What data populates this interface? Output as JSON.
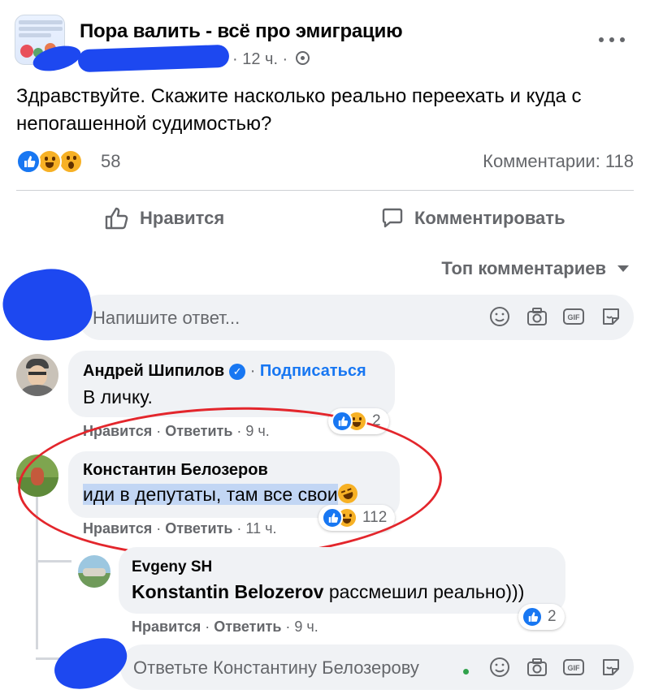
{
  "post": {
    "group_name": "Пора валить - всё про эмиграцию",
    "time_ago": "12 ч.",
    "text": "Здравствуйте. Скажите насколько реально переехать и куда с непогашенной судимостью?",
    "reaction_count": "58",
    "comments_label": "Комментарии: 118",
    "like_label": "Нравится",
    "comment_label": "Комментировать",
    "reaction_types": [
      "like",
      "haha",
      "wow"
    ]
  },
  "comments_section": {
    "sort_label": "Топ комментариев",
    "reply_placeholder": "Напишите ответ...",
    "input_icons": [
      "smiley-icon",
      "camera-icon",
      "gif-icon",
      "sticker-icon"
    ]
  },
  "comments": [
    {
      "author": "Андрей Шипилов",
      "follow_label": "Подписаться",
      "text": "В личку.",
      "like_action": "Нравится",
      "reply_action": "Ответить",
      "time": "9 ч.",
      "reaction_count": "2"
    },
    {
      "author": "Константин Белозеров",
      "text": "иди в депутаты, там все свои",
      "like_action": "Нравится",
      "reply_action": "Ответить",
      "time": "11 ч.",
      "reaction_count": "112"
    }
  ],
  "reply": {
    "author": "Evgeny SH",
    "mention": "Konstantin Belozerov",
    "text": "рассмешил реально)))",
    "like_action": "Нравится",
    "reply_action": "Ответить",
    "time": "9 ч.",
    "reaction_count": "2"
  },
  "reply_input": {
    "placeholder": "Ответьте Константину Белозерову"
  },
  "colors": {
    "accent": "#1877f2",
    "redaction": "#1d48f0",
    "annotation": "#e3262c",
    "bubble": "#f0f2f5",
    "highlight": "#c2d6f4"
  }
}
